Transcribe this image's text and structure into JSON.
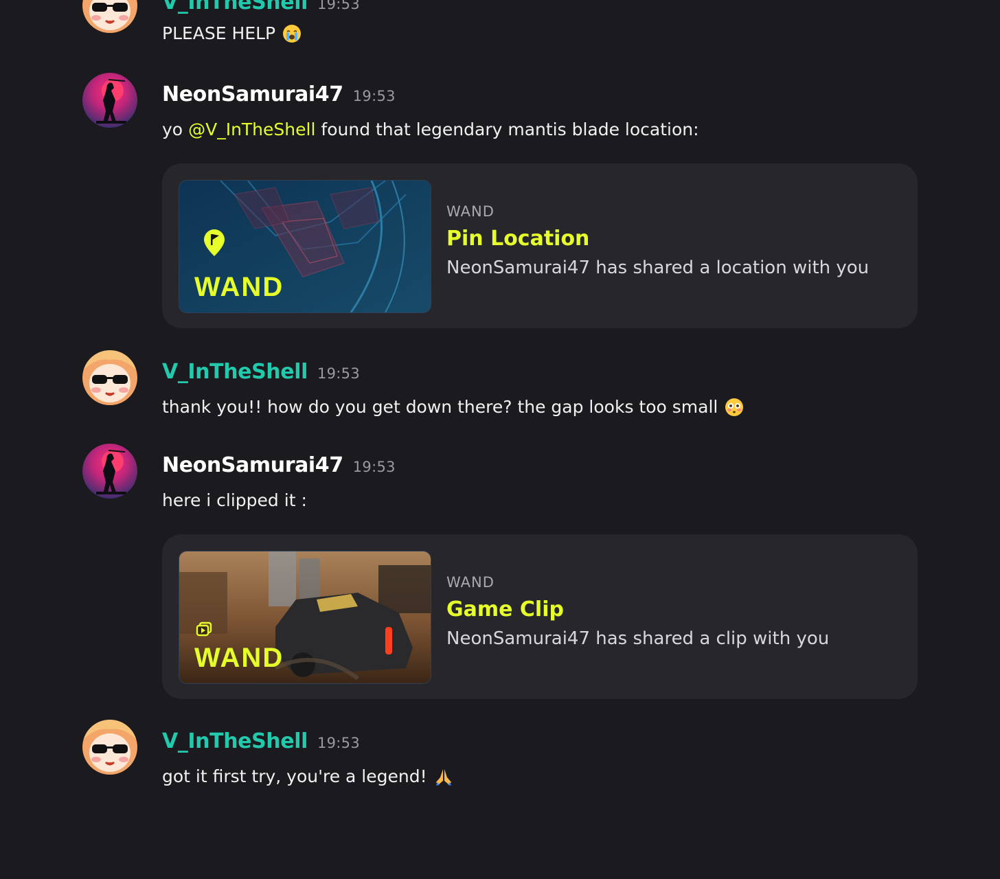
{
  "messages": [
    {
      "user": "V_InTheShell",
      "time": "19:53",
      "text": "PLEASE HELP",
      "emoji": "loudly-crying-face-icon"
    },
    {
      "user": "NeonSamurai47",
      "time": "19:53",
      "text_pre": "yo",
      "mention": "@V_InTheShell",
      "text_post": "found that legendary mantis blade location:",
      "embed": {
        "provider": "WAND",
        "title": "Pin Location",
        "description": "NeonSamurai47 has shared a location with you",
        "thumb_logo": "WAND",
        "thumb_icon": "pin-flag-icon"
      }
    },
    {
      "user": "V_InTheShell",
      "time": "19:53",
      "text": "thank you!! how do you get down there? the gap looks too small",
      "emoji": "flushed-face-icon"
    },
    {
      "user": "NeonSamurai47",
      "time": "19:53",
      "text": "here i clipped it :",
      "embed": {
        "provider": "WAND",
        "title": "Game Clip",
        "description": "NeonSamurai47 has shared a clip with you",
        "thumb_logo": "WAND",
        "thumb_icon": "clip-play-icon"
      }
    },
    {
      "user": "V_InTheShell",
      "time": "19:53",
      "text": "got it first try, you're a legend!",
      "emoji": "folded-hands-icon"
    }
  ],
  "colors": {
    "background": "#1b1b1f",
    "embed_bg": "#27272b",
    "accent_yellow": "#e6ff2b",
    "username_teal": "#22c9ac",
    "timestamp": "#9a9aa2"
  }
}
